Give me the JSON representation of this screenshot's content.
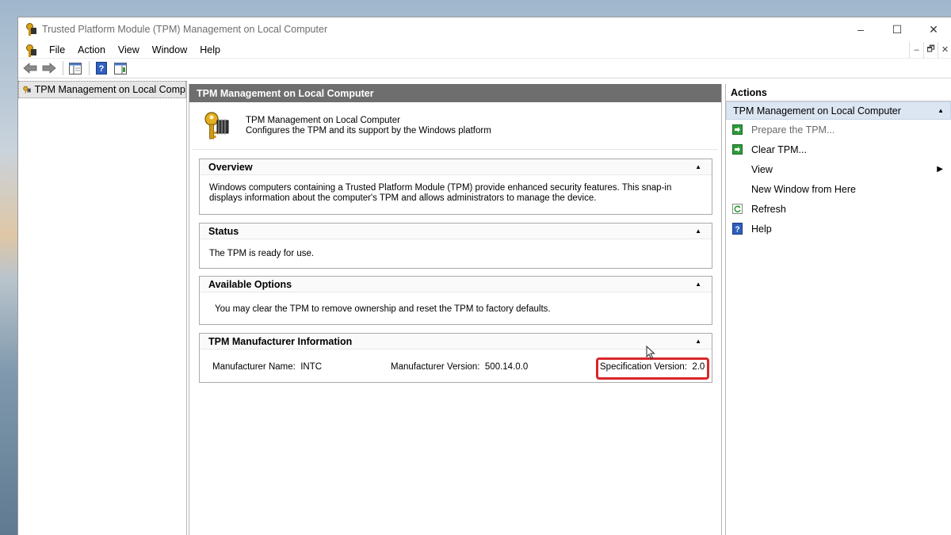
{
  "window": {
    "title": "Trusted Platform Module (TPM) Management on Local Computer",
    "controls": {
      "minimize": "–",
      "maximize": "☐",
      "close": "✕"
    }
  },
  "menubar": {
    "items": [
      "File",
      "Action",
      "View",
      "Window",
      "Help"
    ],
    "mdi": {
      "minimize": "–",
      "restore": "🗗",
      "close": "✕"
    }
  },
  "tree": {
    "root_label": "TPM Management on Local Comp"
  },
  "center": {
    "header": "TPM Management on Local Computer",
    "intro": {
      "title": "TPM Management on Local Computer",
      "description": "Configures the TPM and its support by the Windows platform"
    },
    "sections": {
      "overview": {
        "title": "Overview",
        "body": "Windows computers containing a Trusted Platform Module (TPM) provide enhanced security features. This snap-in displays information about the computer's TPM and allows administrators to manage the device."
      },
      "status": {
        "title": "Status",
        "body": "The TPM is ready for use."
      },
      "options": {
        "title": "Available Options",
        "body": "You may clear the TPM to remove ownership and reset the TPM to factory defaults."
      },
      "manufacturer": {
        "title": "TPM Manufacturer Information",
        "name_label": "Manufacturer Name:",
        "name_value": "INTC",
        "version_label": "Manufacturer Version:",
        "version_value": "500.14.0.0",
        "spec_label": "Specification Version:",
        "spec_value": "2.0"
      }
    }
  },
  "actions": {
    "header": "Actions",
    "group": "TPM Management on Local Computer",
    "items": [
      "Prepare the TPM...",
      "Clear TPM...",
      "View",
      "New Window from Here",
      "Refresh",
      "Help"
    ]
  },
  "colors": {
    "highlight": "#d9262b",
    "center_header_bg": "#6e6e6e",
    "action_group_bg": "#dce6f2"
  }
}
